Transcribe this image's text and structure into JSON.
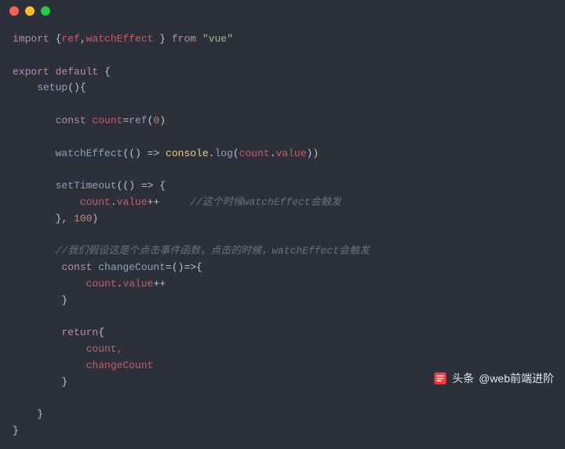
{
  "code": {
    "line1_import": "import",
    "line1_brace_open": " {",
    "line1_ref": "ref",
    "line1_comma": ",",
    "line1_watchEffect": "watchEffect",
    "line1_brace_close": " } ",
    "line1_from": "from",
    "line1_vue": " \"vue\"",
    "line3_export": "export",
    "line3_default": " default",
    "line3_brace": " {",
    "line4_setup": "    setup",
    "line4_paren": "(){",
    "line6_const": "       const",
    "line6_count": " count",
    "line6_eq": "=",
    "line6_ref": "ref",
    "line6_paren_open": "(",
    "line6_zero": "0",
    "line6_paren_close": ")",
    "line8_watchEffect": "       watchEffect",
    "line8_args": "(() => ",
    "line8_console": "console",
    "line8_dot": ".",
    "line8_log": "log",
    "line8_paren_open": "(",
    "line8_count": "count",
    "line8_dot2": ".",
    "line8_value": "value",
    "line8_close": "))",
    "line10_setTimeout": "       setTimeout",
    "line10_args": "(() => {",
    "line11_count": "           count",
    "line11_dot": ".",
    "line11_value": "value",
    "line11_inc": "++",
    "line11_comment": "     //这个时候watchEffect会触发",
    "line12_close": "       }, ",
    "line12_num": "100",
    "line12_paren": ")",
    "line14_comment": "       //我们假设这是个点击事件函数，点击的时候，watchEffect会触发",
    "line15_const": "        const",
    "line15_changeCount": " changeCount",
    "line15_eq": "=()=>{",
    "line16_count": "            count",
    "line16_dot": ".",
    "line16_value": "value",
    "line16_inc": "++",
    "line17_brace": "        }",
    "line19_return": "        return",
    "line19_brace": "{",
    "line20_count": "            count,",
    "line21_changeCount": "            changeCount",
    "line22_brace": "        }",
    "line24_brace": "    }",
    "line25_brace": "}"
  },
  "watermark": {
    "label": "头条",
    "handle": "@web前端进阶"
  }
}
